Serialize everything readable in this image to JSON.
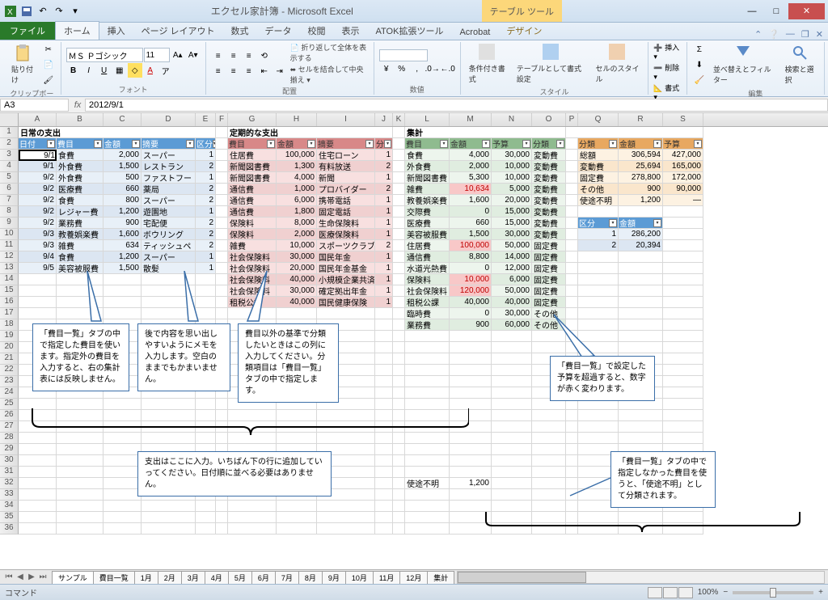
{
  "app": {
    "title": "エクセル家計簿 - Microsoft Excel",
    "context_tool": "テーブル ツール"
  },
  "tabs": {
    "file": "ファイル",
    "home": "ホーム",
    "insert": "挿入",
    "layout": "ページ レイアウト",
    "formulas": "数式",
    "data": "データ",
    "review": "校閲",
    "view": "表示",
    "atok": "ATOK拡張ツール",
    "acrobat": "Acrobat",
    "design": "デザイン"
  },
  "ribbon": {
    "paste": "貼り付け",
    "clipboard": "クリップボード",
    "font_name": "ＭＳ Ｐゴシック",
    "font_size": "11",
    "font_grp": "フォント",
    "wrap": "折り返して全体を表示する",
    "merge": "セルを結合して中央揃え",
    "align_grp": "配置",
    "num_grp": "数値",
    "cond": "条件付き書式",
    "tblfmt": "テーブルとして書式設定",
    "cellstyle": "セルのスタイル",
    "style_grp": "スタイル",
    "ins": "挿入",
    "del": "削除",
    "fmt": "書式",
    "cell_grp": "セル",
    "sort": "並べ替えとフィルター",
    "find": "検索と選択",
    "edit_grp": "編集"
  },
  "namebox": "A3",
  "formula": "2012/9/1",
  "cols": [
    "A",
    "B",
    "C",
    "D",
    "E",
    "F",
    "G",
    "H",
    "I",
    "J",
    "K",
    "L",
    "M",
    "N",
    "O",
    "P",
    "Q",
    "R",
    "S"
  ],
  "sect": {
    "s1": "日常の支出",
    "s2": "定期的な支出",
    "s3": "集計"
  },
  "hdr": {
    "date": "日付",
    "item": "費目",
    "amount": "金額",
    "memo": "摘要",
    "class": "区分",
    "cls2": "分",
    "budget": "予算",
    "cat": "分類"
  },
  "t1": [
    {
      "d": "9/1",
      "i": "食費",
      "a": "2,000",
      "m": "スーパー",
      "c": "1"
    },
    {
      "d": "9/1",
      "i": "外食費",
      "a": "1,500",
      "m": "レストラン",
      "c": "2"
    },
    {
      "d": "9/2",
      "i": "外食費",
      "a": "500",
      "m": "ファストフー",
      "c": "1"
    },
    {
      "d": "9/2",
      "i": "医療費",
      "a": "660",
      "m": "薬局",
      "c": "2"
    },
    {
      "d": "9/2",
      "i": "食費",
      "a": "800",
      "m": "スーパー",
      "c": "2"
    },
    {
      "d": "9/2",
      "i": "レジャー費",
      "a": "1,200",
      "m": "遊園地",
      "c": "1"
    },
    {
      "d": "9/2",
      "i": "業務費",
      "a": "900",
      "m": "宅配便",
      "c": "2"
    },
    {
      "d": "9/3",
      "i": "教養娯楽費",
      "a": "1,600",
      "m": "ボウリング",
      "c": "2"
    },
    {
      "d": "9/3",
      "i": "雑費",
      "a": "634",
      "m": "ティッシュペ",
      "c": "2"
    },
    {
      "d": "9/4",
      "i": "食費",
      "a": "1,200",
      "m": "スーパー",
      "c": "1"
    },
    {
      "d": "9/5",
      "i": "美容被服費",
      "a": "1,500",
      "m": "散髪",
      "c": "1"
    }
  ],
  "t2": [
    {
      "i": "住居費",
      "a": "100,000",
      "m": "住宅ローン",
      "c": "1"
    },
    {
      "i": "新聞図書費",
      "a": "1,300",
      "m": "有料放送",
      "c": "2"
    },
    {
      "i": "新聞図書費",
      "a": "4,000",
      "m": "新聞",
      "c": "1"
    },
    {
      "i": "通信費",
      "a": "1,000",
      "m": "プロバイダー",
      "c": "2"
    },
    {
      "i": "通信費",
      "a": "6,000",
      "m": "携帯電話",
      "c": "1"
    },
    {
      "i": "通信費",
      "a": "1,800",
      "m": "固定電話",
      "c": "1"
    },
    {
      "i": "保険料",
      "a": "8,000",
      "m": "生命保険料",
      "c": "1"
    },
    {
      "i": "保険料",
      "a": "2,000",
      "m": "医療保険料",
      "c": "1"
    },
    {
      "i": "雑費",
      "a": "10,000",
      "m": "スポーツクラブ",
      "c": "2"
    },
    {
      "i": "社会保険料",
      "a": "30,000",
      "m": "国民年金",
      "c": "1"
    },
    {
      "i": "社会保険料",
      "a": "20,000",
      "m": "国民年金基金",
      "c": "1"
    },
    {
      "i": "社会保険料",
      "a": "40,000",
      "m": "小規模企業共済",
      "c": "1"
    },
    {
      "i": "社会保険料",
      "a": "30,000",
      "m": "確定拠出年金",
      "c": "1"
    },
    {
      "i": "租税公課",
      "a": "40,000",
      "m": "国民健康保険",
      "c": "1"
    }
  ],
  "t3": [
    {
      "i": "食費",
      "a": "4,000",
      "b": "30,000",
      "c": "変動費",
      "red": false
    },
    {
      "i": "外食費",
      "a": "2,000",
      "b": "10,000",
      "c": "変動費",
      "red": false
    },
    {
      "i": "新聞図書費",
      "a": "5,300",
      "b": "10,000",
      "c": "変動費",
      "red": false
    },
    {
      "i": "雑費",
      "a": "10,634",
      "b": "5,000",
      "c": "変動費",
      "red": true
    },
    {
      "i": "教養娯楽費",
      "a": "1,600",
      "b": "20,000",
      "c": "変動費",
      "red": false
    },
    {
      "i": "交際費",
      "a": "0",
      "b": "15,000",
      "c": "変動費",
      "red": false
    },
    {
      "i": "医療費",
      "a": "660",
      "b": "15,000",
      "c": "変動費",
      "red": false
    },
    {
      "i": "美容被服費",
      "a": "1,500",
      "b": "30,000",
      "c": "変動費",
      "red": false
    },
    {
      "i": "住居費",
      "a": "100,000",
      "b": "50,000",
      "c": "固定費",
      "red": true
    },
    {
      "i": "通信費",
      "a": "8,800",
      "b": "14,000",
      "c": "固定費",
      "red": false
    },
    {
      "i": "水道光熱費",
      "a": "0",
      "b": "12,000",
      "c": "固定費",
      "red": false
    },
    {
      "i": "保険料",
      "a": "10,000",
      "b": "6,000",
      "c": "固定費",
      "red": true
    },
    {
      "i": "社会保険料",
      "a": "120,000",
      "b": "50,000",
      "c": "固定費",
      "red": true
    },
    {
      "i": "租税公課",
      "a": "40,000",
      "b": "40,000",
      "c": "固定費",
      "red": false
    },
    {
      "i": "臨時費",
      "a": "0",
      "b": "30,000",
      "c": "その他",
      "red": false
    },
    {
      "i": "業務費",
      "a": "900",
      "b": "60,000",
      "c": "その他",
      "red": false
    }
  ],
  "t4": [
    {
      "c": "総額",
      "a": "306,594",
      "b": "427,000"
    },
    {
      "c": "変動費",
      "a": "25,694",
      "b": "165,000"
    },
    {
      "c": "固定費",
      "a": "278,800",
      "b": "172,000"
    },
    {
      "c": "その他",
      "a": "900",
      "b": "90,000"
    },
    {
      "c": "使途不明",
      "a": "1,200",
      "b": "—"
    }
  ],
  "t5": [
    {
      "c": "1",
      "a": "286,200"
    },
    {
      "c": "2",
      "a": "20,394"
    }
  ],
  "unknown": {
    "label": "使途不明",
    "val": "1,200"
  },
  "callouts": {
    "c1": "「費目一覧」タブの中で指定した費目を使います。指定外の費目を入力すると、右の集計表には反映しません。",
    "c2": "後で内容を思い出しやすいようにメモを入力します。空白のままでもかまいません。",
    "c3": "費目以外の基準で分類したいときはこの列に入力してください。分類項目は「費目一覧」タブの中で指定します。",
    "c4": "支出はここに入力。いちばん下の行に追加していってください。日付順に並べる必要はありません。",
    "c5": "「費目一覧」で設定した予算を超過すると、数字が赤く変わります。",
    "c6": "「費目一覧」タブの中で指定しなかった費目を使うと、「使途不明」として分類されます。"
  },
  "sheets": [
    "サンプル",
    "費目一覧",
    "1月",
    "2月",
    "3月",
    "4月",
    "5月",
    "6月",
    "7月",
    "8月",
    "9月",
    "10月",
    "11月",
    "12月",
    "集計"
  ],
  "status": {
    "mode": "コマンド",
    "zoom": "100%"
  }
}
